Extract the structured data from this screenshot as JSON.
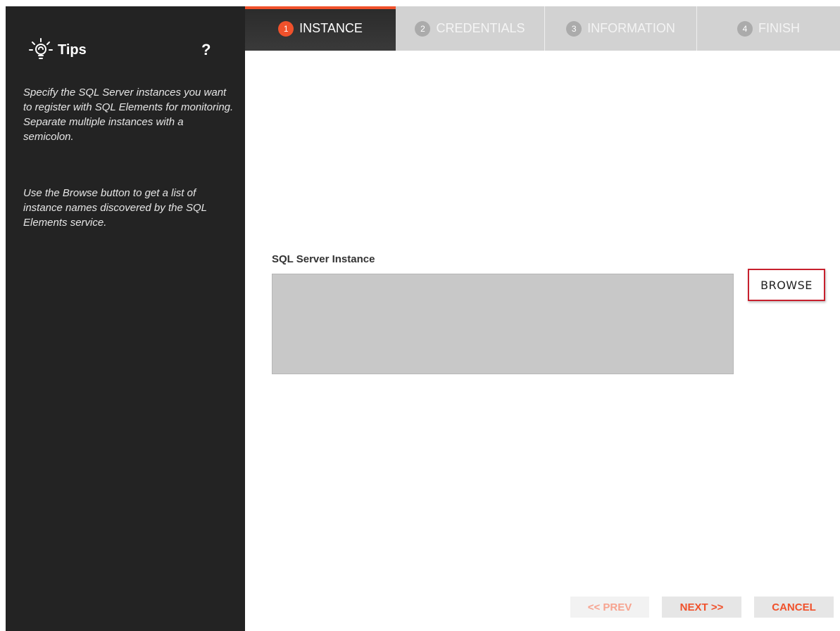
{
  "sidebar": {
    "title": "Tips",
    "help": "?",
    "paragraphs": [
      "Specify the SQL Server instances you want to register with SQL Elements for monitoring. Separate multiple instances with a semicolon.",
      "Use the Browse button to get a list of instance names discovered by the SQL Elements service."
    ]
  },
  "steps": [
    {
      "num": "1",
      "label": "INSTANCE"
    },
    {
      "num": "2",
      "label": "CREDENTIALS"
    },
    {
      "num": "3",
      "label": "INFORMATION"
    },
    {
      "num": "4",
      "label": "FINISH"
    }
  ],
  "form": {
    "label": "SQL Server Instance",
    "value": "",
    "browse_label": "BROWSE"
  },
  "footer": {
    "prev_label": "<< PREV",
    "next_label": "NEXT >>",
    "cancel_label": "CANCEL"
  },
  "colors": {
    "accent": "#f0512b",
    "sidebar_bg": "#232323",
    "browse_border": "#c7202d"
  },
  "icons": {
    "tips": "lightbulb-icon"
  }
}
